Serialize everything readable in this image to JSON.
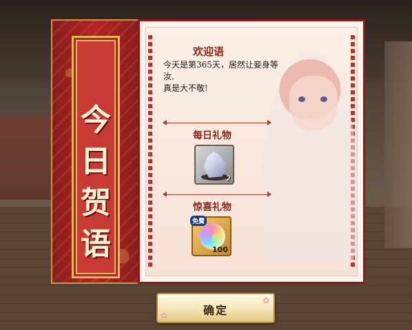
{
  "banner": {
    "title_chars": [
      "今",
      "日",
      "贺",
      "语"
    ]
  },
  "greeting": {
    "title": "欢迎语",
    "lines": [
      "今天是第365天，居然让妾身等",
      "汝,",
      "真是大不敬!"
    ]
  },
  "daily_gift": {
    "title": "每日礼物",
    "item": {
      "icon": "crystal-icon",
      "count": "2"
    }
  },
  "surprise_gift": {
    "title": "惊喜礼物",
    "item": {
      "icon": "rainbow-orb-icon",
      "badge": "免費",
      "count": "100"
    }
  },
  "confirm_button": {
    "label": "确定"
  },
  "colors": {
    "banner_red": "#b52424",
    "gold": "#e0b85a",
    "title_red": "#8a2a1a"
  }
}
